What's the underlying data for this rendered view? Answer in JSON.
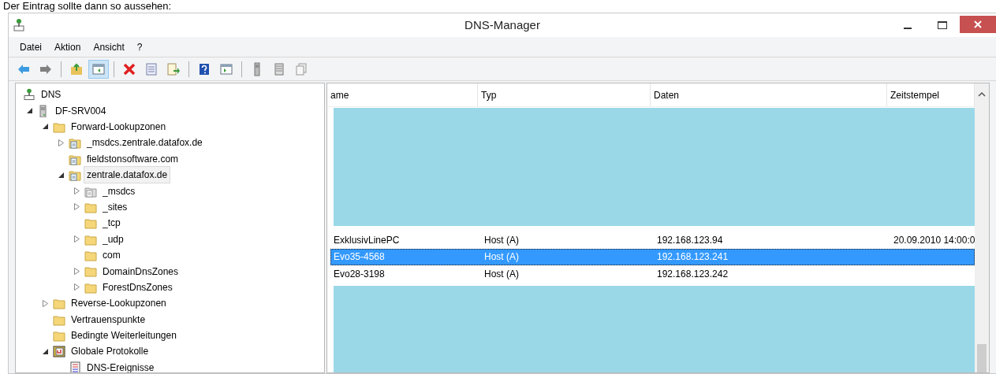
{
  "caption": "Der Eintrag sollte dann so aussehen:",
  "window": {
    "title": "DNS-Manager"
  },
  "menu": [
    "Datei",
    "Aktion",
    "Ansicht",
    "?"
  ],
  "toolbar": [
    {
      "kind": "back",
      "pressed": false
    },
    {
      "kind": "forward",
      "pressed": false
    },
    {
      "kind": "sep"
    },
    {
      "kind": "up",
      "pressed": false
    },
    {
      "kind": "tree",
      "pressed": true
    },
    {
      "kind": "sep"
    },
    {
      "kind": "delete",
      "pressed": false
    },
    {
      "kind": "properties",
      "pressed": false
    },
    {
      "kind": "export",
      "pressed": false
    },
    {
      "kind": "sep"
    },
    {
      "kind": "help",
      "pressed": false
    },
    {
      "kind": "pane",
      "pressed": false
    },
    {
      "kind": "sep"
    },
    {
      "kind": "server",
      "pressed": false
    },
    {
      "kind": "list",
      "pressed": false
    },
    {
      "kind": "copy",
      "pressed": false
    }
  ],
  "tree": [
    {
      "label": "DNS",
      "kind": "dns",
      "selected": false,
      "children": [
        {
          "label": "DF-SRV004",
          "kind": "server",
          "expanded": true,
          "selected": false,
          "children": [
            {
              "label": "Forward-Lookupzonen",
              "kind": "folder",
              "expanded": true,
              "selected": false,
              "children": [
                {
                  "label": "_msdcs.zentrale.datafox.de",
                  "kind": "zone",
                  "expanded": false,
                  "selected": false
                },
                {
                  "label": "fieldstonsoftware.com",
                  "kind": "zone",
                  "selected": false
                },
                {
                  "label": "zentrale.datafox.de",
                  "kind": "zone",
                  "expanded": true,
                  "selected": true,
                  "children": [
                    {
                      "label": "_msdcs",
                      "kind": "delegation",
                      "expanded": false,
                      "selected": false
                    },
                    {
                      "label": "_sites",
                      "kind": "folder",
                      "expanded": false,
                      "selected": false
                    },
                    {
                      "label": "_tcp",
                      "kind": "folder",
                      "selected": false
                    },
                    {
                      "label": "_udp",
                      "kind": "folder",
                      "expanded": false,
                      "selected": false
                    },
                    {
                      "label": "com",
                      "kind": "folder",
                      "selected": false
                    },
                    {
                      "label": "DomainDnsZones",
                      "kind": "folder",
                      "expanded": false,
                      "selected": false
                    },
                    {
                      "label": "ForestDnsZones",
                      "kind": "folder",
                      "expanded": false,
                      "selected": false
                    }
                  ]
                }
              ]
            },
            {
              "label": "Reverse-Lookupzonen",
              "kind": "folder",
              "expanded": false,
              "selected": false
            },
            {
              "label": "Vertrauenspunkte",
              "kind": "folder",
              "selected": false
            },
            {
              "label": "Bedingte Weiterleitungen",
              "kind": "folder",
              "selected": false
            },
            {
              "label": "Globale Protokolle",
              "kind": "log",
              "expanded": true,
              "selected": false,
              "children": [
                {
                  "label": "DNS-Ereignisse",
                  "kind": "event",
                  "selected": false
                }
              ]
            }
          ]
        }
      ]
    }
  ],
  "table": {
    "columns": [
      "ame",
      "Typ",
      "Daten",
      "Zeitstempel"
    ],
    "rows": [
      {
        "cells": [
          "ExklusivLinePC",
          "Host (A)",
          "192.168.123.94",
          "20.09.2010 14:00:0"
        ],
        "selected": false
      },
      {
        "cells": [
          "Evo35-4568",
          "Host (A)",
          "192.168.123.241"
        ],
        "selected": true
      },
      {
        "cells": [
          "Evo28-3198",
          "Host (A)",
          "192.168.123.242"
        ],
        "selected": false
      }
    ]
  }
}
